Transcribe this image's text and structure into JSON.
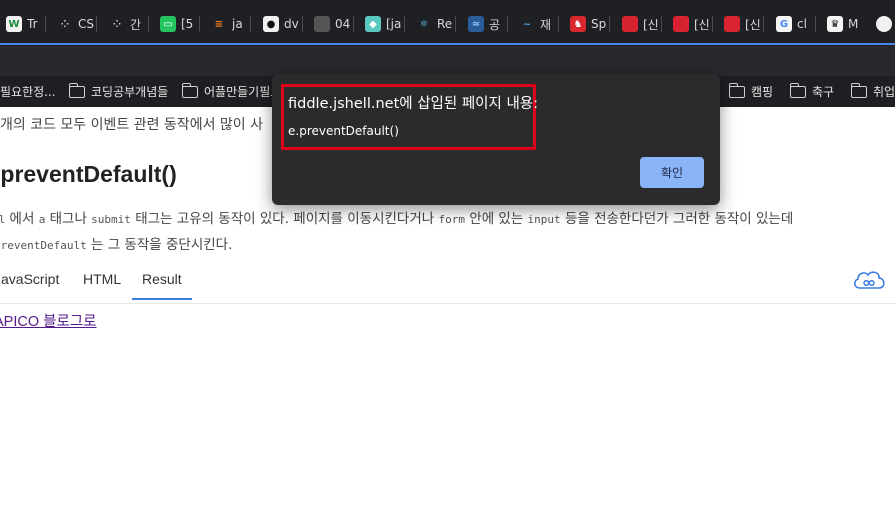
{
  "browser": {
    "tabs": [
      {
        "label": "Tr",
        "icon": "w-icon",
        "color": "#f2f2f2",
        "fg": "#1a8a3a",
        "glyph": "W"
      },
      {
        "label": "CS",
        "icon": "dots-icon",
        "color": "#1f2023",
        "fg": "#cccccc",
        "glyph": "⁘"
      },
      {
        "label": "간",
        "icon": "dots-icon",
        "color": "#1f2023",
        "fg": "#cccccc",
        "glyph": "⁘"
      },
      {
        "label": "[5",
        "icon": "chat-icon",
        "color": "#23c45e",
        "fg": "#ffffff",
        "glyph": "▭"
      },
      {
        "label": "ja",
        "icon": "stackoverflow-icon",
        "color": "#1f2023",
        "fg": "#f48024",
        "glyph": "≡"
      },
      {
        "label": "dv",
        "icon": "github-icon",
        "color": "#f0f0f0",
        "fg": "#111111",
        "glyph": "●"
      },
      {
        "label": "04",
        "icon": "page-icon",
        "color": "#555555",
        "fg": "#555555",
        "glyph": ""
      },
      {
        "label": "[ja",
        "icon": "app-icon",
        "color": "#5bc8c0",
        "fg": "#ffffff",
        "glyph": "◆"
      },
      {
        "label": "Re",
        "icon": "react-icon",
        "color": "#1f2023",
        "fg": "#61dafb",
        "glyph": "⚛"
      },
      {
        "label": "공",
        "icon": "wave-icon",
        "color": "#2a5d9c",
        "fg": "#9fd0ff",
        "glyph": "≈"
      },
      {
        "label": "재",
        "icon": "bird-icon",
        "color": "#1f2023",
        "fg": "#4fa0e0",
        "glyph": "~"
      },
      {
        "label": "Sp",
        "icon": "shield-icon",
        "color": "#d8282e",
        "fg": "#ffffff",
        "glyph": "♞"
      },
      {
        "label": "[신",
        "icon": "book-icon",
        "color": "#d82430",
        "fg": "#d82430",
        "glyph": ""
      },
      {
        "label": "[신",
        "icon": "book-icon",
        "color": "#d82430",
        "fg": "#d82430",
        "glyph": ""
      },
      {
        "label": "[신",
        "icon": "book-icon",
        "color": "#d82430",
        "fg": "#d82430",
        "glyph": ""
      },
      {
        "label": "cl",
        "icon": "google-icon",
        "color": "#f5f5f5",
        "fg": "#4285f4",
        "glyph": "G"
      },
      {
        "label": "M",
        "icon": "crown-icon",
        "color": "#f5f5f5",
        "fg": "#111111",
        "glyph": "♛"
      }
    ],
    "bookmarks": [
      {
        "label": "필요한정...",
        "folder": false
      },
      {
        "label": "코딩공부개념들",
        "folder": true
      },
      {
        "label": "어플만들기필요",
        "folder": true
      },
      {
        "label": "캠핑",
        "folder": true
      },
      {
        "label": "축구",
        "folder": true
      },
      {
        "label": "취업",
        "folder": true
      }
    ]
  },
  "page": {
    "intro": "개의 코드 모두 이벤트 관련 동작에서 많이 사",
    "heading": ".preventDefault()",
    "para1": {
      "c1": "ml",
      "t1": " 에서 ",
      "c2": "a",
      "t2": " 태그나 ",
      "c3": "submit",
      "t3": " 태그는 고유의 동작이 있다. 페이지를 이동시킨다거나 ",
      "c4": "form",
      "t4": " 안에 있는 ",
      "c5": "input",
      "t5": " 등을 전송한다던가 그러한 동작이 있는데"
    },
    "para2": {
      "c1": "preventDefault",
      "t1": " 는 그 동작을 중단시킨다."
    },
    "tabs": {
      "javascript": "JavaScript",
      "html": "HTML",
      "result": "Result"
    },
    "link": "APICO 블로그로"
  },
  "dialog": {
    "title": "fiddle.jshell.net에 삽입된 페이지 내용:",
    "message": "e.preventDefault()",
    "ok": "확인"
  }
}
